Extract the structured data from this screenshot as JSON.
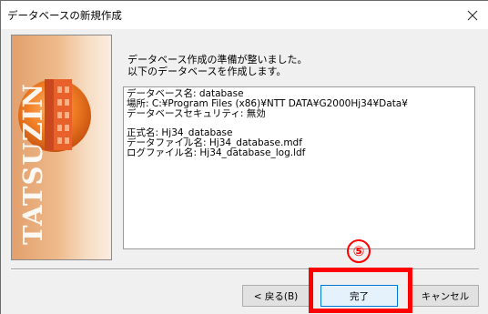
{
  "window": {
    "title": "データベースの新規作成"
  },
  "banner": {
    "logo_text": "TATSUZIN"
  },
  "intro": {
    "line1": "データベース作成の準備が整いました。",
    "line2": "以下のデータベースを作成します。"
  },
  "summary": {
    "db_name": "データベース名:  database",
    "location": "場所:  C:¥Program Files (x86)¥NTT DATA¥G2000Hj34¥Data¥",
    "security": "データベースセキュリティ:  無効",
    "formal_name": "正式名:  Hj34_database",
    "data_file": "データファイル名:  Hj34_database.mdf",
    "log_file": "ログファイル名:  Hj34_database_log.ldf"
  },
  "buttons": {
    "back": "< 戻る(B)",
    "finish": "完了",
    "cancel": "キャンセル"
  },
  "annotation": {
    "step_number": "⑤",
    "color": "#ff0000"
  },
  "icons": {
    "close": "close-icon",
    "building": "building-icon"
  }
}
